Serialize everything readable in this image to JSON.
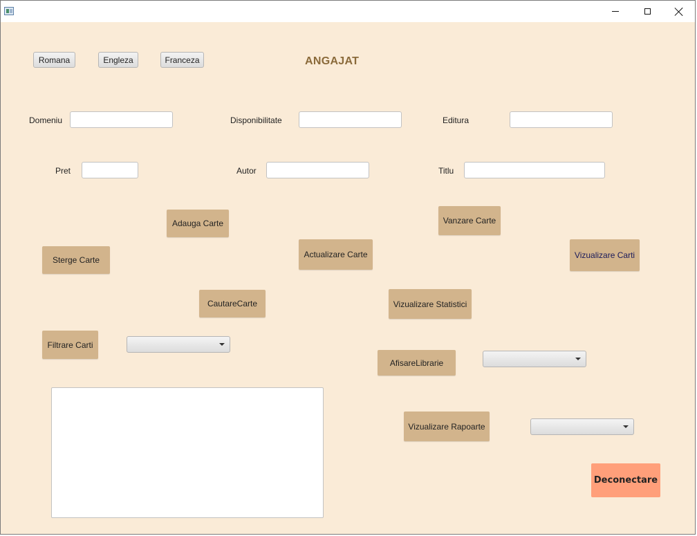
{
  "window": {
    "icon": "app-window-icon",
    "controls": [
      "minimize-icon",
      "maximize-icon",
      "close-icon"
    ]
  },
  "languages": {
    "romana": "Romana",
    "engleza": "Engleza",
    "franceza": "Franceza"
  },
  "heading": "ANGAJAT",
  "fields": {
    "domeniu": {
      "label": "Domeniu",
      "value": ""
    },
    "disponibilitate": {
      "label": "Disponibilitate",
      "value": ""
    },
    "editura": {
      "label": "Editura",
      "value": ""
    },
    "pret": {
      "label": "Pret",
      "value": ""
    },
    "autor": {
      "label": "Autor",
      "value": ""
    },
    "titlu": {
      "label": "Titlu",
      "value": ""
    }
  },
  "actions": {
    "adauga": "Adauga Carte",
    "vanzare": "Vanzare Carte",
    "sterge": "Sterge Carte",
    "actualizare": "Actualizare Carte",
    "vizualizare_carti": "Vizualizare Carti",
    "cautare": "CautareCarte",
    "statistici": "Vizualizare Statistici",
    "filtrare": "Filtrare Carti",
    "afisare_librarie": "AfisareLibrarie",
    "rapoarte": "Vizualizare Rapoarte"
  },
  "dropdowns": {
    "filtrare_selected": "",
    "librarie_selected": "",
    "rapoarte_selected": ""
  },
  "output_text": "",
  "logout": "Deconectare",
  "colors": {
    "background": "#faebd7",
    "action_button": "#d2b48c",
    "logout_button": "#ff9f7a",
    "heading": "#8a6a3a"
  }
}
